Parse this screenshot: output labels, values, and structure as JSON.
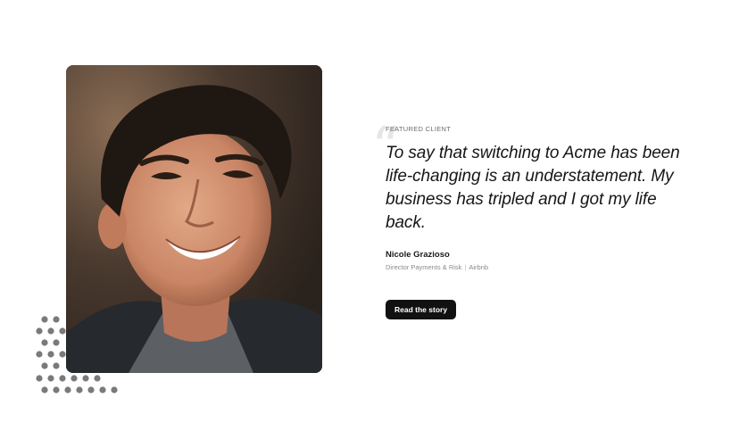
{
  "testimonial": {
    "eyebrow": "FEATURED CLIENT",
    "quote_mark": "“",
    "quote": "To say that switching to Acme has been life-changing is an understatement. My business has tripled and I got my life back.",
    "author": {
      "name": "Nicole Grazioso",
      "title": "Director Payments & Risk",
      "separator": "|",
      "company": "Airbnb"
    },
    "cta_label": "Read the story"
  },
  "colors": {
    "accent": "#111111",
    "dots": "#7a7a7a",
    "quote_mark": "#e6e6e6"
  },
  "icons": {
    "decoration": "dot-grid-icon"
  }
}
